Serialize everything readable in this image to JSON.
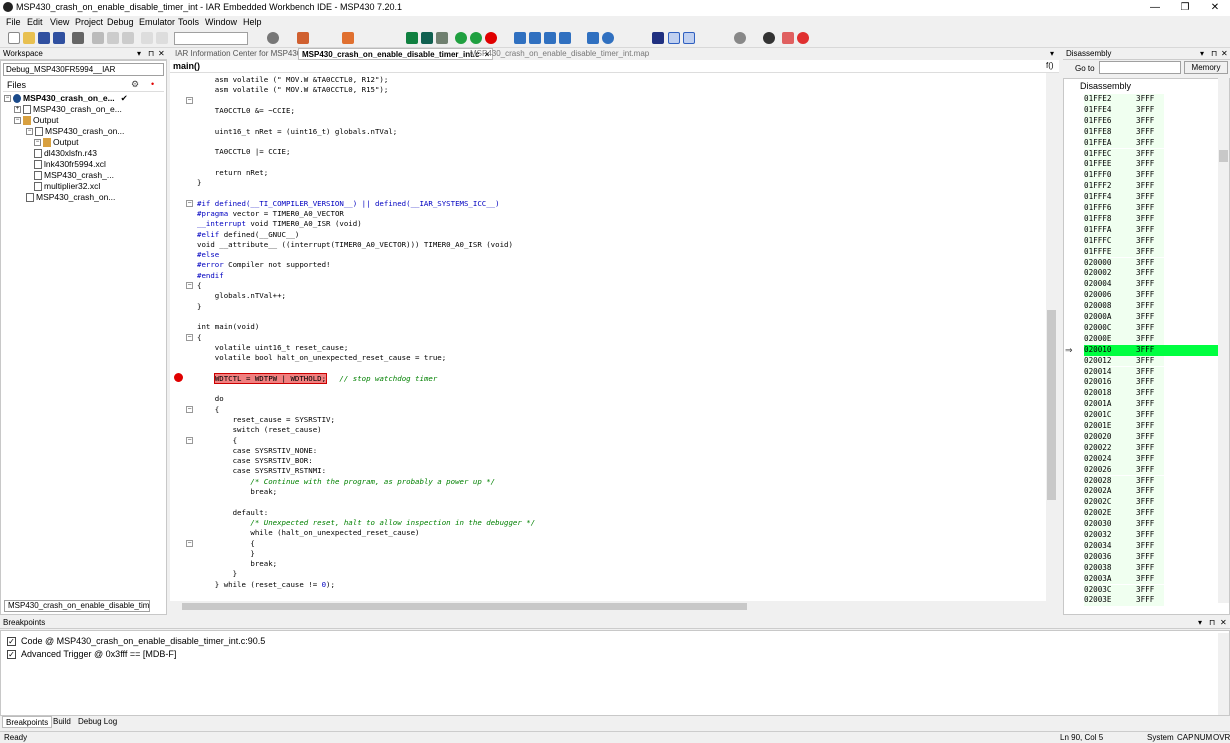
{
  "window": {
    "title": "MSP430_crash_on_enable_disable_timer_int - IAR Embedded Workbench IDE - MSP430 7.20.1",
    "min": "—",
    "max": "❐",
    "close": "✕"
  },
  "menu": [
    "File",
    "Edit",
    "View",
    "Project",
    "Debug",
    "Emulator",
    "Tools",
    "Window",
    "Help"
  ],
  "workspace": {
    "header": "Workspace",
    "config": "Debug_MSP430FR5994__IAR",
    "files_label": "Files",
    "tree": [
      {
        "label": "MSP430_crash_on_e...",
        "level": 0,
        "bold": true,
        "check": "✔"
      },
      {
        "label": "MSP430_crash_on_e...",
        "level": 1
      },
      {
        "label": "Output",
        "level": 1,
        "folder": true
      },
      {
        "label": "MSP430_crash_on...",
        "level": 2
      },
      {
        "label": "Output",
        "level": 3,
        "folder": true
      },
      {
        "label": "dl430xlsfn.r43",
        "level": 3
      },
      {
        "label": "lnk430fr5994.xcl",
        "level": 3
      },
      {
        "label": "MSP430_crash_...",
        "level": 3
      },
      {
        "label": "multiplier32.xcl",
        "level": 3
      },
      {
        "label": "MSP430_crash_on...",
        "level": 2
      }
    ],
    "bottom_tab": "MSP430_crash_on_enable_disable_timer_int"
  },
  "editor": {
    "tabs": [
      {
        "label": "IAR Information Center for MSP430",
        "active": false
      },
      {
        "label": "MSP430_crash_on_enable_disable_timer_int.c",
        "active": true,
        "close": "×"
      },
      {
        "label": "MSP430_crash_on_enable_disable_timer_int.map",
        "active": false
      }
    ],
    "function": "main()",
    "func_icon": "f()",
    "lines": [
      [
        [
          "    asm volatile (\" MOV.W &TA0CCTL0, R12\");",
          ""
        ]
      ],
      [
        [
          "    asm volatile (\" MOV.W &TA0CCTL0, R15\");",
          ""
        ]
      ],
      [
        [
          "",
          ""
        ]
      ],
      [
        [
          "    TA0CCTL0 &= ~CCIE;",
          ""
        ]
      ],
      [
        [
          "",
          ""
        ]
      ],
      [
        [
          "    uint16_t nRet = (uint16_t) globals.nTVal;",
          ""
        ]
      ],
      [
        [
          "",
          ""
        ]
      ],
      [
        [
          "    TA0CCTL0 |= CCIE;",
          ""
        ]
      ],
      [
        [
          "",
          ""
        ]
      ],
      [
        [
          "    return nRet;",
          ""
        ]
      ],
      [
        [
          "}",
          ""
        ]
      ],
      [
        [
          "",
          ""
        ]
      ],
      [
        [
          "#if defined(__TI_COMPILER_VERSION__) || defined(__IAR_SYSTEMS_ICC__)",
          "kw"
        ]
      ],
      [
        [
          "#pragma",
          "kw"
        ],
        [
          " vector = TIMER0_A0_VECTOR",
          ""
        ]
      ],
      [
        [
          "__interrupt",
          "kw"
        ],
        [
          " void TIMER0_A0_ISR (void)",
          ""
        ]
      ],
      [
        [
          "#elif",
          "kw"
        ],
        [
          " defined(__GNUC__)",
          ""
        ]
      ],
      [
        [
          "void __attribute__ ((interrupt(TIMER0_A0_VECTOR))) TIMER0_A0_ISR (void)",
          ""
        ]
      ],
      [
        [
          "#else",
          "kw"
        ]
      ],
      [
        [
          "#error",
          "kw"
        ],
        [
          " Compiler not supported!",
          ""
        ]
      ],
      [
        [
          "#endif",
          "kw"
        ]
      ],
      [
        [
          "{",
          ""
        ]
      ],
      [
        [
          "    globals.nTVal++;",
          ""
        ]
      ],
      [
        [
          "}",
          ""
        ]
      ],
      [
        [
          "",
          ""
        ]
      ],
      [
        [
          "int main(void)",
          ""
        ]
      ],
      [
        [
          "{",
          ""
        ]
      ],
      [
        [
          "    volatile uint16_t reset_cause;",
          ""
        ]
      ],
      [
        [
          "    volatile bool halt_on_unexpected_reset_cause = true;",
          ""
        ]
      ],
      [
        [
          "",
          ""
        ]
      ],
      [
        [
          "    WDTCTL = WDTPW | WDTHOLD;",
          "hl"
        ],
        [
          "   // stop watchdog timer",
          "cm"
        ]
      ],
      [
        [
          "",
          ""
        ]
      ],
      [
        [
          "    do",
          ""
        ]
      ],
      [
        [
          "    {",
          ""
        ]
      ],
      [
        [
          "        reset_cause = SYSRSTIV;",
          ""
        ]
      ],
      [
        [
          "        switch (reset_cause)",
          ""
        ]
      ],
      [
        [
          "        {",
          ""
        ]
      ],
      [
        [
          "        case SYSRSTIV_NONE:",
          ""
        ]
      ],
      [
        [
          "        case SYSRSTIV_BOR:",
          ""
        ]
      ],
      [
        [
          "        case SYSRSTIV_RSTNMI:",
          ""
        ]
      ],
      [
        [
          "            ",
          ""
        ],
        [
          "/* Continue with the program, as probably a power up */",
          "cm"
        ]
      ],
      [
        [
          "            break;",
          ""
        ]
      ],
      [
        [
          "",
          ""
        ]
      ],
      [
        [
          "        default:",
          ""
        ]
      ],
      [
        [
          "            ",
          ""
        ],
        [
          "/* Unexpected reset, halt to allow inspection in the debugger */",
          "cm"
        ]
      ],
      [
        [
          "            while (halt_on_unexpected_reset_cause)",
          ""
        ]
      ],
      [
        [
          "            {",
          ""
        ]
      ],
      [
        [
          "            }",
          ""
        ]
      ],
      [
        [
          "            break;",
          ""
        ]
      ],
      [
        [
          "        }",
          ""
        ]
      ],
      [
        [
          "    } while (reset_cause != ",
          ""
        ],
        [
          "0",
          "kw"
        ],
        [
          ");",
          ""
        ]
      ]
    ]
  },
  "disassembly": {
    "header": "Disassembly",
    "goto_label": "Go to",
    "memory_label": "Memory",
    "column": "Disassembly",
    "rows": [
      [
        "01FFE2",
        "3FFF"
      ],
      [
        "01FFE4",
        "3FFF"
      ],
      [
        "01FFE6",
        "3FFF"
      ],
      [
        "01FFE8",
        "3FFF"
      ],
      [
        "01FFEA",
        "3FFF"
      ],
      [
        "01FFEC",
        "3FFF"
      ],
      [
        "01FFEE",
        "3FFF"
      ],
      [
        "01FFF0",
        "3FFF"
      ],
      [
        "01FFF2",
        "3FFF"
      ],
      [
        "01FFF4",
        "3FFF"
      ],
      [
        "01FFF6",
        "3FFF"
      ],
      [
        "01FFF8",
        "3FFF"
      ],
      [
        "01FFFA",
        "3FFF"
      ],
      [
        "01FFFC",
        "3FFF"
      ],
      [
        "01FFFE",
        "3FFF"
      ],
      [
        "020000",
        "3FFF"
      ],
      [
        "020002",
        "3FFF"
      ],
      [
        "020004",
        "3FFF"
      ],
      [
        "020006",
        "3FFF"
      ],
      [
        "020008",
        "3FFF"
      ],
      [
        "02000A",
        "3FFF"
      ],
      [
        "02000C",
        "3FFF"
      ],
      [
        "02000E",
        "3FFF"
      ],
      [
        "020010",
        "3FFF"
      ],
      [
        "020012",
        "3FFF"
      ],
      [
        "020014",
        "3FFF"
      ],
      [
        "020016",
        "3FFF"
      ],
      [
        "020018",
        "3FFF"
      ],
      [
        "02001A",
        "3FFF"
      ],
      [
        "02001C",
        "3FFF"
      ],
      [
        "02001E",
        "3FFF"
      ],
      [
        "020020",
        "3FFF"
      ],
      [
        "020022",
        "3FFF"
      ],
      [
        "020024",
        "3FFF"
      ],
      [
        "020026",
        "3FFF"
      ],
      [
        "020028",
        "3FFF"
      ],
      [
        "02002A",
        "3FFF"
      ],
      [
        "02002C",
        "3FFF"
      ],
      [
        "02002E",
        "3FFF"
      ],
      [
        "020030",
        "3FFF"
      ],
      [
        "020032",
        "3FFF"
      ],
      [
        "020034",
        "3FFF"
      ],
      [
        "020036",
        "3FFF"
      ],
      [
        "020038",
        "3FFF"
      ],
      [
        "02003A",
        "3FFF"
      ],
      [
        "02003C",
        "3FFF"
      ],
      [
        "02003E",
        "3FFF"
      ]
    ],
    "current_index": 23
  },
  "breakpoints": {
    "header": "Breakpoints",
    "items": [
      "Code @ MSP430_crash_on_enable_disable_timer_int.c:90.5",
      "Advanced Trigger @ 0x3fff == [MDB-F]"
    ],
    "check": "✓"
  },
  "bottom_tabs": [
    "Breakpoints",
    "Build",
    "Debug Log"
  ],
  "status": {
    "left": "Ready",
    "position": "Ln 90, Col 5",
    "system": "System",
    "caps": "CAP",
    "num": "NUM",
    "ovr": "OVR"
  },
  "colors": {
    "current_line": "#00ff40",
    "breakpoint": "#e00000",
    "breakpoint_highlight": "#f08080"
  }
}
